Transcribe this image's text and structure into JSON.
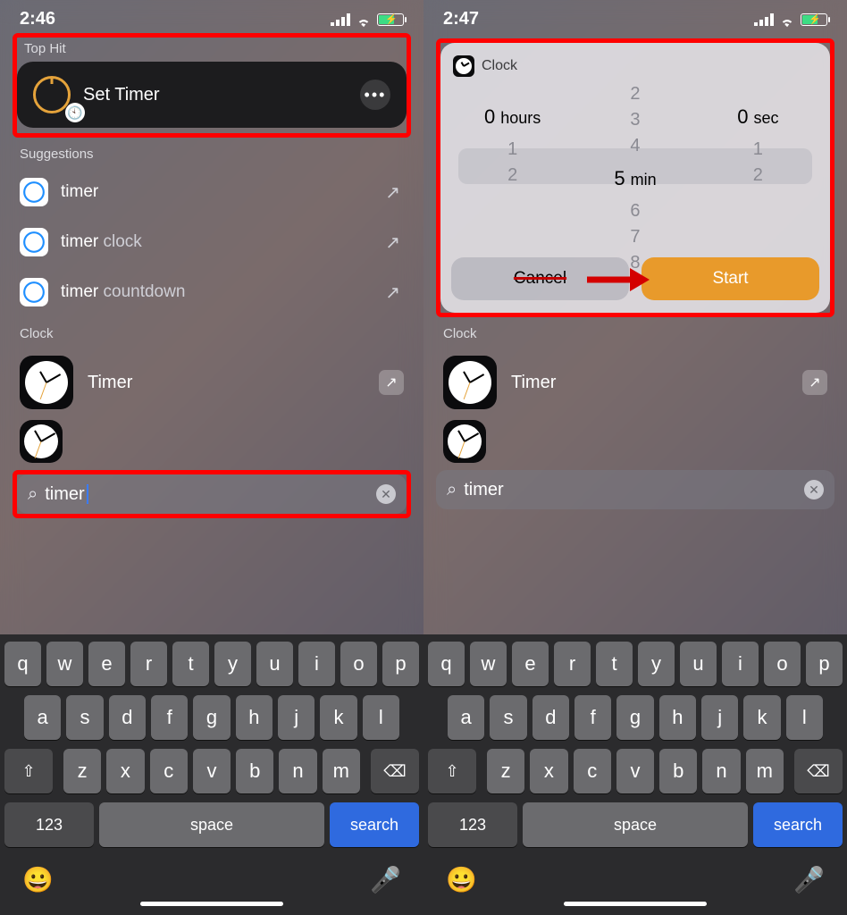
{
  "left": {
    "status_time": "2:46",
    "top_hit_label": "Top Hit",
    "top_hit_title": "Set Timer",
    "suggestions_label": "Suggestions",
    "suggestions": [
      {
        "prefix": "timer",
        "suffix": ""
      },
      {
        "prefix": "timer",
        "suffix": " clock"
      },
      {
        "prefix": "timer",
        "suffix": " countdown"
      }
    ],
    "clock_section": "Clock",
    "clock_row": "Timer",
    "search_value": "timer"
  },
  "right": {
    "status_time": "2:47",
    "widget_app": "Clock",
    "picker": {
      "hours": {
        "above": [
          "",
          "",
          ""
        ],
        "sel_val": "0",
        "sel_unit": "hours",
        "below": [
          "1",
          "2",
          ""
        ]
      },
      "min": {
        "above": [
          "2",
          "3",
          "4"
        ],
        "sel_val": "5",
        "sel_unit": "min",
        "below": [
          "6",
          "7",
          "8"
        ]
      },
      "sec": {
        "above": [
          "",
          "",
          ""
        ],
        "sel_val": "0",
        "sel_unit": "sec",
        "below": [
          "1",
          "2",
          ""
        ]
      }
    },
    "cancel": "Cancel",
    "start": "Start",
    "clock_section": "Clock",
    "clock_row": "Timer",
    "search_value": "timer"
  },
  "keyboard": {
    "r1": [
      "q",
      "w",
      "e",
      "r",
      "t",
      "y",
      "u",
      "i",
      "o",
      "p"
    ],
    "r2": [
      "a",
      "s",
      "d",
      "f",
      "g",
      "h",
      "j",
      "k",
      "l"
    ],
    "r3": [
      "z",
      "x",
      "c",
      "v",
      "b",
      "n",
      "m"
    ],
    "num": "123",
    "space": "space",
    "search": "search"
  }
}
